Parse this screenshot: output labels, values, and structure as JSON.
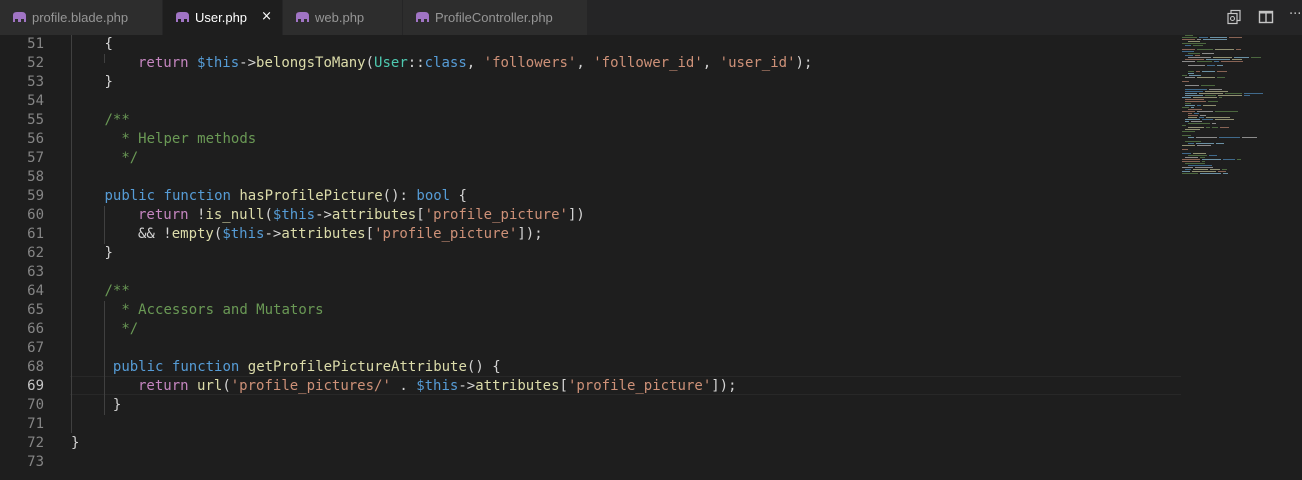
{
  "tabs": [
    {
      "label": "profile.blade.php",
      "active": false
    },
    {
      "label": "User.php",
      "active": true,
      "close": "×"
    },
    {
      "label": "web.php",
      "active": false
    },
    {
      "label": "ProfileController.php",
      "active": false
    }
  ],
  "editor_actions": {
    "more": "···"
  },
  "lines": [
    {
      "n": "51",
      "t": [
        [
          "{",
          "p"
        ]
      ]
    },
    {
      "n": "52",
      "t": [
        [
          "return ",
          "ctl"
        ],
        [
          "$this",
          "v"
        ],
        [
          "->",
          "p"
        ],
        [
          "belongsToMany",
          "f"
        ],
        [
          "(",
          "p"
        ],
        [
          "User",
          "cl"
        ],
        [
          "::",
          "p"
        ],
        [
          "class",
          "k"
        ],
        [
          ", ",
          "p"
        ],
        [
          "'followers'",
          "s"
        ],
        [
          ", ",
          "p"
        ],
        [
          "'follower_id'",
          "s"
        ],
        [
          ", ",
          "p"
        ],
        [
          "'user_id'",
          "s"
        ],
        [
          ");",
          "p"
        ]
      ]
    },
    {
      "n": "53",
      "t": [
        [
          "}",
          "p"
        ]
      ]
    },
    {
      "n": "54",
      "t": []
    },
    {
      "n": "55",
      "t": [
        [
          "/**",
          "c"
        ]
      ]
    },
    {
      "n": "56",
      "t": [
        [
          " * Helper methods",
          "c"
        ]
      ]
    },
    {
      "n": "57",
      "t": [
        [
          " */",
          "c"
        ]
      ]
    },
    {
      "n": "58",
      "t": []
    },
    {
      "n": "59",
      "t": [
        [
          "public ",
          "k"
        ],
        [
          "function ",
          "k"
        ],
        [
          "hasProfilePicture",
          "f"
        ],
        [
          "(): ",
          "p"
        ],
        [
          "bool ",
          "k"
        ],
        [
          "{",
          "p"
        ]
      ]
    },
    {
      "n": "60",
      "t": [
        [
          "return ",
          "ctl"
        ],
        [
          "!",
          "p"
        ],
        [
          "is_null",
          "f"
        ],
        [
          "(",
          "p"
        ],
        [
          "$this",
          "v"
        ],
        [
          "->",
          "p"
        ],
        [
          "attributes",
          "f"
        ],
        [
          "[",
          "p"
        ],
        [
          "'profile_picture'",
          "s"
        ],
        [
          "])",
          "p"
        ]
      ]
    },
    {
      "n": "61",
      "t": [
        [
          "&& !",
          "p"
        ],
        [
          "empty",
          "f"
        ],
        [
          "(",
          "p"
        ],
        [
          "$this",
          "v"
        ],
        [
          "->",
          "p"
        ],
        [
          "attributes",
          "f"
        ],
        [
          "[",
          "p"
        ],
        [
          "'profile_picture'",
          "s"
        ],
        [
          "]);",
          "p"
        ]
      ]
    },
    {
      "n": "62",
      "t": [
        [
          "}",
          "p"
        ]
      ]
    },
    {
      "n": "63",
      "t": []
    },
    {
      "n": "64",
      "t": [
        [
          "/**",
          "c"
        ]
      ]
    },
    {
      "n": "65",
      "t": [
        [
          " * Accessors and Mutators",
          "c"
        ]
      ]
    },
    {
      "n": "66",
      "t": [
        [
          " */",
          "c"
        ]
      ]
    },
    {
      "n": "67",
      "t": []
    },
    {
      "n": "68",
      "t": [
        [
          "public ",
          "k"
        ],
        [
          "function ",
          "k"
        ],
        [
          "getProfilePictureAttribute",
          "f"
        ],
        [
          "() ",
          "p"
        ],
        [
          "{",
          "p"
        ]
      ]
    },
    {
      "n": "69",
      "t": [
        [
          "return ",
          "ctl"
        ],
        [
          "url",
          "f"
        ],
        [
          "(",
          "p"
        ],
        [
          "'profile_pictures/'",
          "s"
        ],
        [
          " . ",
          "p"
        ],
        [
          "$this",
          "v"
        ],
        [
          "->",
          "p"
        ],
        [
          "attributes",
          "f"
        ],
        [
          "[",
          "p"
        ],
        [
          "'profile_picture'",
          "s"
        ],
        [
          "]);",
          "p"
        ]
      ]
    },
    {
      "n": "70",
      "t": [
        [
          "}",
          "p"
        ]
      ]
    },
    {
      "n": "71",
      "t": []
    },
    {
      "n": "72",
      "t": [
        [
          "}",
          "p"
        ]
      ]
    },
    {
      "n": "73",
      "t": []
    }
  ],
  "current_line": "69",
  "colors": {
    "keyword": "#569cd6",
    "function": "#dcdcaa",
    "string": "#ce9178",
    "comment": "#6a9955",
    "class": "#4ec9b0",
    "editor_bg": "#1e1e1e",
    "tab_icon": "#a074c4"
  }
}
